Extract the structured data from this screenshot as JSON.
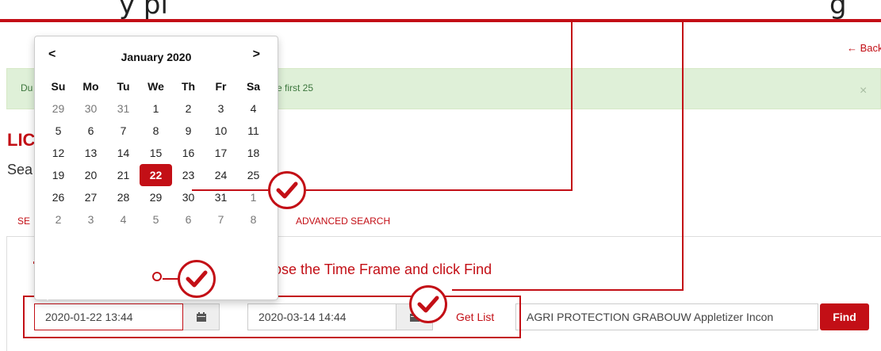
{
  "top_caption": {
    "left_text": "y pl",
    "right_text": "g"
  },
  "back_link": {
    "label": "Back"
  },
  "alert": {
    "text_left": "Du",
    "text_right": "e first 25",
    "close": "×"
  },
  "page": {
    "title_fragment": "LIC",
    "search_fragment": "Sea"
  },
  "tabs": [
    {
      "label": "SE"
    },
    {
      "label": "ADVANCED SEARCH"
    }
  ],
  "instruction": {
    "text": "ose the Time Frame and click Find"
  },
  "date_from": {
    "value": "2020-01-22 13:44"
  },
  "date_to": {
    "value": "2020-03-14 14:44"
  },
  "get_list": {
    "label": "Get List"
  },
  "search_box": {
    "value": "AGRI PROTECTION GRABOUW Appletizer Incon"
  },
  "find_button": {
    "label": "Find"
  },
  "calendar": {
    "month_label": "January 2020",
    "prev": "<",
    "next": ">",
    "weekdays": [
      "Su",
      "Mo",
      "Tu",
      "We",
      "Th",
      "Fr",
      "Sa"
    ],
    "weeks": [
      [
        "29",
        "30",
        "31",
        "1",
        "2",
        "3",
        "4"
      ],
      [
        "5",
        "6",
        "7",
        "8",
        "9",
        "10",
        "11"
      ],
      [
        "12",
        "13",
        "14",
        "15",
        "16",
        "17",
        "18"
      ],
      [
        "19",
        "20",
        "21",
        "22",
        "23",
        "24",
        "25"
      ],
      [
        "26",
        "27",
        "28",
        "29",
        "30",
        "31",
        "1"
      ],
      [
        "2",
        "3",
        "4",
        "5",
        "6",
        "7",
        "8"
      ]
    ],
    "selected": "22"
  },
  "colors": {
    "accent": "#c30f16",
    "alert_bg": "#dff0d8",
    "alert_text": "#3c763d"
  }
}
